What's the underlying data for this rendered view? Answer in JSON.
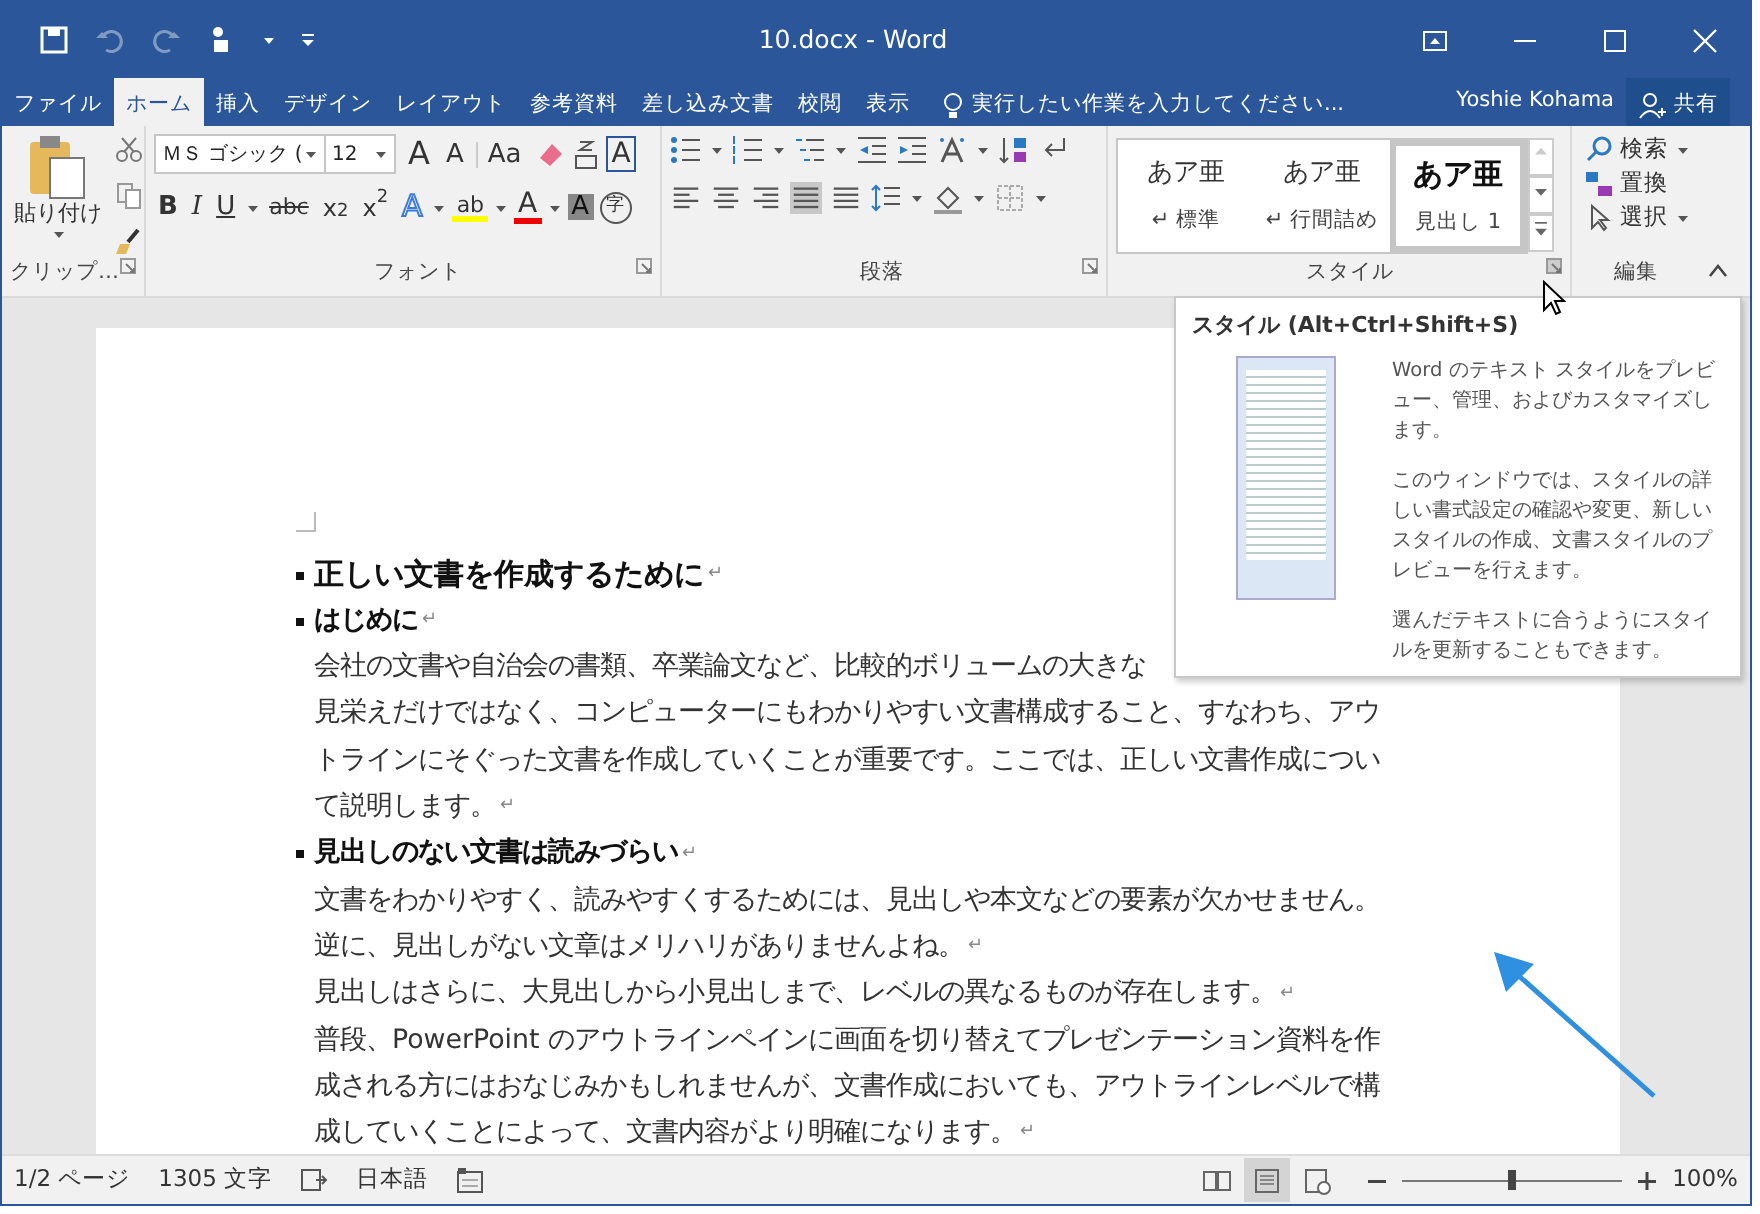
{
  "window": {
    "title": "10.docx - Word"
  },
  "quick_access": [
    {
      "kind": "save",
      "disabled": false
    },
    {
      "kind": "undo",
      "disabled": true
    },
    {
      "kind": "redo",
      "disabled": true
    },
    {
      "kind": "touch",
      "disabled": false
    }
  ],
  "tabs": [
    {
      "label": "ファイル",
      "selected": false
    },
    {
      "label": "ホーム",
      "selected": true
    },
    {
      "label": "挿入",
      "selected": false
    },
    {
      "label": "デザイン",
      "selected": false
    },
    {
      "label": "レイアウト",
      "selected": false
    },
    {
      "label": "参考資料",
      "selected": false
    },
    {
      "label": "差し込み文書",
      "selected": false
    },
    {
      "label": "校閲",
      "selected": false
    },
    {
      "label": "表示",
      "selected": false
    }
  ],
  "tell_me": {
    "label": "実行したい作業を入力してください..."
  },
  "user": "Yoshie Kohama",
  "share": {
    "label": "共有"
  },
  "ribbon": {
    "clipboard": {
      "paste_label": "貼り付け",
      "group_label": "クリップ…"
    },
    "font": {
      "font_name": "ＭＳ ゴシック (",
      "font_size": "12",
      "group_label": "フォント",
      "row1": [
        {
          "kind": "grow",
          "label": "A"
        },
        {
          "kind": "shrink",
          "label": "A"
        },
        {
          "kind": "case",
          "label": "Aa"
        },
        {
          "kind": "clear"
        },
        {
          "kind": "phonetic"
        },
        {
          "kind": "border",
          "label": "A"
        }
      ],
      "row2": [
        {
          "kind": "bold",
          "label": "B"
        },
        {
          "kind": "italic",
          "label": "I"
        },
        {
          "kind": "underline",
          "label": "U"
        },
        {
          "kind": "strike",
          "label": "abc"
        },
        {
          "kind": "sub",
          "label": "x$_{2}$"
        },
        {
          "kind": "sup",
          "label": "x$^{2}$"
        },
        {
          "kind": "effect",
          "label": "A"
        },
        {
          "kind": "highlight",
          "label": "ab"
        },
        {
          "kind": "color",
          "label": "A"
        },
        {
          "kind": "shading",
          "label": "A"
        },
        {
          "kind": "enclose",
          "label": "字"
        }
      ]
    },
    "paragraph": {
      "group_label": "段落",
      "align": [
        {
          "kind": "left",
          "selected": false
        },
        {
          "kind": "center",
          "selected": false
        },
        {
          "kind": "right",
          "selected": false
        },
        {
          "kind": "justify",
          "selected": true
        },
        {
          "kind": "distribute",
          "selected": false
        }
      ]
    },
    "styles": {
      "group_label": "スタイル",
      "items": [
        {
          "sample": "あア亜",
          "name": "標準",
          "mark": "↵",
          "selected": false
        },
        {
          "sample": "あア亜",
          "name": "行間詰め",
          "mark": "↵",
          "selected": false
        },
        {
          "sample": "あア亜",
          "name": "見出し 1",
          "selected": true
        }
      ]
    },
    "editing": {
      "group_label": "編集",
      "items": [
        {
          "kind": "find",
          "label": "検索"
        },
        {
          "kind": "replace",
          "label": "置換"
        },
        {
          "kind": "select",
          "label": "選択"
        }
      ]
    }
  },
  "tooltip": {
    "title": "スタイル (Alt+Ctrl+Shift+S)",
    "paragraphs": [
      "Word のテキスト スタイルをプレビュー、管理、およびカスタマイズします。",
      "このウィンドウでは、スタイルの詳しい書式設定の確認や変更、新しいスタイルの作成、文書スタイルのプレビューを行えます。",
      "選んだテキストに合うようにスタイルを更新することもできます。"
    ]
  },
  "document": [
    {
      "kind": "heading1",
      "text": "正しい文書を作成するために",
      "mark": "↵"
    },
    {
      "kind": "heading2",
      "text": "はじめに",
      "mark": "↵"
    },
    {
      "kind": "body",
      "text": "会社の文書や自治会の書類、卒業論文など、比較的ボリュームの大きな"
    },
    {
      "kind": "body",
      "text": "見栄えだけではなく、コンピューターにもわかりやすい文書構成すること、すなわち、アウ"
    },
    {
      "kind": "body",
      "text": "トラインにそぐった文書を作成していくことが重要です。ここでは、正しい文書作成につい"
    },
    {
      "kind": "body",
      "text": "て説明します。",
      "mark": "↵"
    },
    {
      "kind": "heading2",
      "text": "見出しのない文書は読みづらい",
      "mark": "↵"
    },
    {
      "kind": "body",
      "text": "文書をわかりやすく、読みやすくするためには、見出しや本文などの要素が欠かせません。"
    },
    {
      "kind": "body",
      "text": "逆に、見出しがない文章はメリハリがありませんよね。",
      "mark": "↵"
    },
    {
      "kind": "body",
      "text": "見出しはさらに、大見出しから小見出しまで、レベルの異なるものが存在します。",
      "mark": "↵"
    },
    {
      "kind": "body",
      "text": "普段、PowerPoint のアウトラインペインに画面を切り替えてプレゼンテーション資料を作"
    },
    {
      "kind": "body",
      "text": "成される方にはおなじみかもしれませんが、文書作成においても、アウトラインレベルで構"
    },
    {
      "kind": "body",
      "text": "成していくことによって、文書内容がより明確になります。",
      "mark": "↵"
    }
  ],
  "status_bar": {
    "page": "1/2 ページ",
    "words": "1305 文字",
    "language": "日本語",
    "views": [
      {
        "kind": "read",
        "selected": false
      },
      {
        "kind": "print",
        "selected": true
      },
      {
        "kind": "web",
        "selected": false
      }
    ],
    "zoom": {
      "level": 0.5,
      "reading": "100%"
    }
  }
}
